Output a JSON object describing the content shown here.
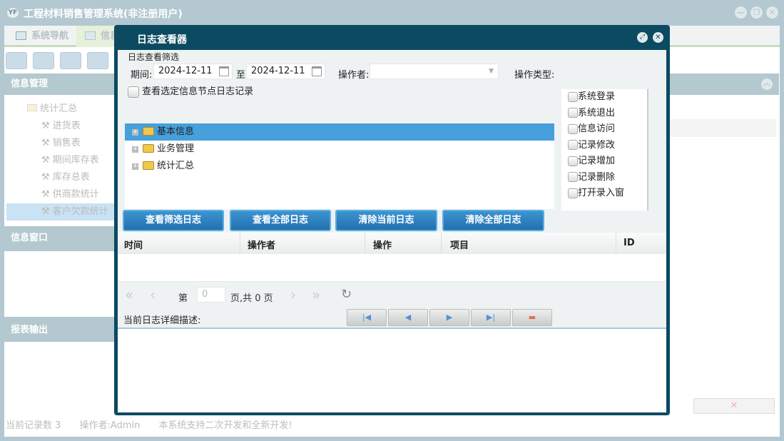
{
  "window": {
    "title": "工程材料销售管理系统(非注册用户)",
    "logo_text": "YF",
    "controls": [
      "minimize",
      "restore",
      "close"
    ]
  },
  "tabs": [
    {
      "label": "系统导航",
      "icon": "monitor-icon"
    },
    {
      "label": "信息",
      "icon": "grid-icon"
    }
  ],
  "toolbar": {
    "icons": [
      "search-icon",
      "list-icon",
      "document-icon",
      "user-icon"
    ]
  },
  "left": {
    "panel1": "信息管理",
    "tree": [
      {
        "label": "统计汇总",
        "type": "folder"
      },
      {
        "label": "进货表"
      },
      {
        "label": "销售表"
      },
      {
        "label": "期间库存表"
      },
      {
        "label": "库存总表"
      },
      {
        "label": "供商款统计"
      },
      {
        "label": "客户欠款统计",
        "selected": true
      }
    ],
    "panel2": "信息窗口",
    "panel3": "报表输出"
  },
  "status": {
    "records": "当前记录数 3",
    "operator": "操作者:Admin",
    "notice": "本系统支持二次开发和全新开发!"
  },
  "dialog": {
    "title": "日志查看器",
    "filter_title": "日志查看筛选",
    "period_label": "期间:",
    "date_from": "2024-12-11",
    "to_label": "至",
    "date_to": "2024-12-11",
    "operator_label": "操作者:",
    "operator_value": "",
    "optype_label": "操作类型:",
    "optypes": [
      "系统登录",
      "系统退出",
      "信息访问",
      "记录修改",
      "记录增加",
      "记录删除",
      "打开录入窗"
    ],
    "node_check_label": "查看选定信息节点日志记录",
    "tree": [
      "基本信息",
      "业务管理",
      "统计汇总"
    ],
    "buttons": [
      "查看筛选日志",
      "查看全部日志",
      "清除当前日志",
      "清除全部日志"
    ],
    "columns": [
      "时间",
      "操作者",
      "操作",
      "项目",
      "ID"
    ],
    "pager": {
      "page_prefix": "第",
      "page_value": "0",
      "page_suffix": "页,共 0 页"
    },
    "detail_label": "当前日志详细描述:"
  },
  "colors": {
    "dialog_frame": "#0b4a61",
    "selected": "#45a0dc",
    "panel_header": "#b3c8cf",
    "button": "#2a7cbc"
  }
}
